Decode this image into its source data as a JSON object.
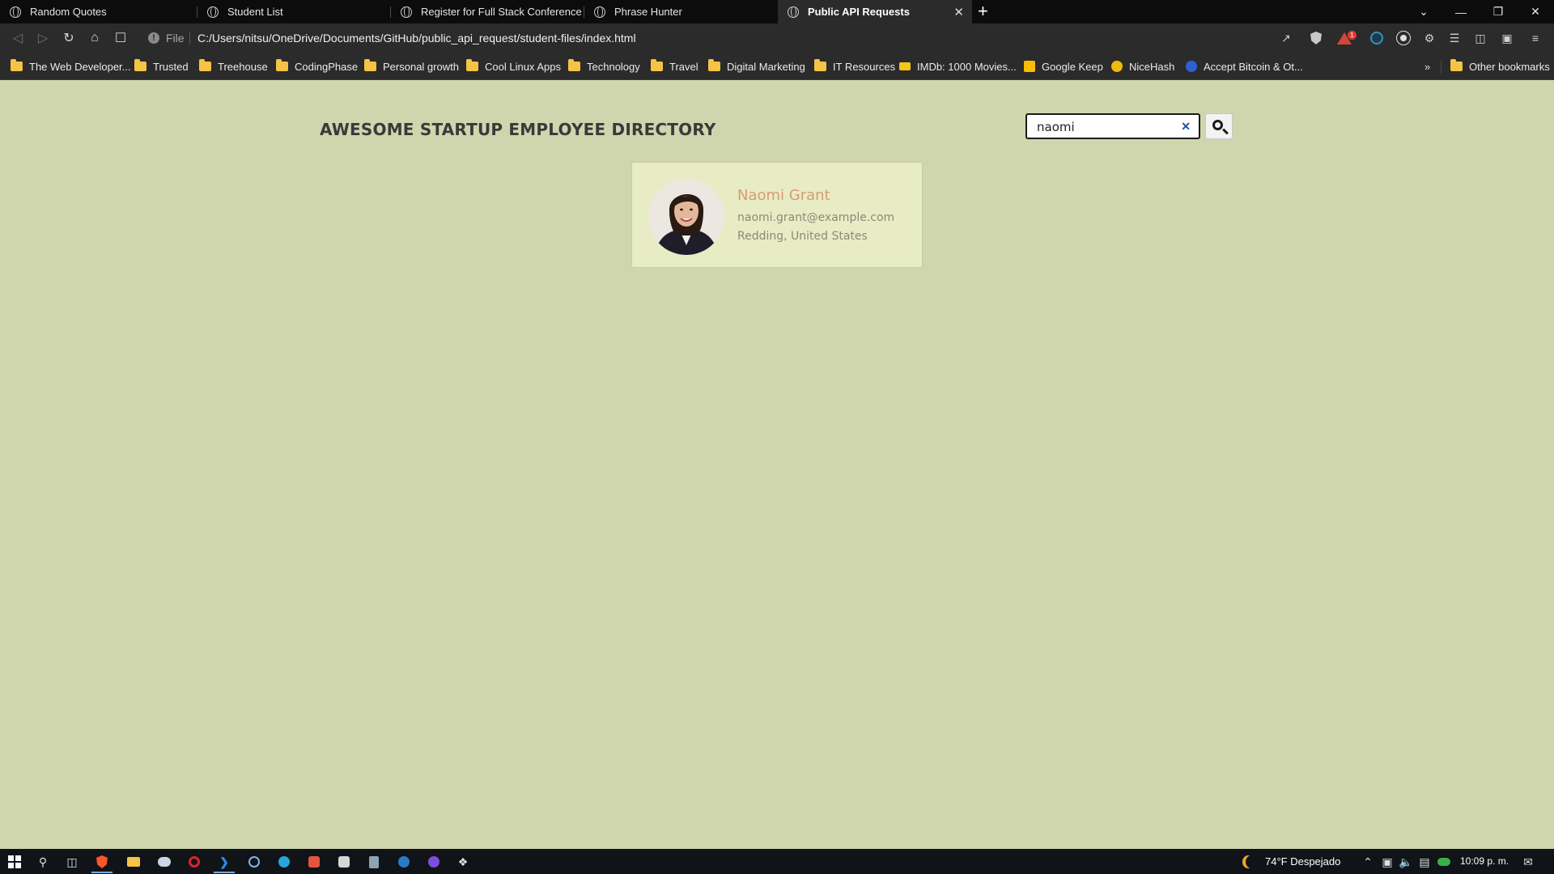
{
  "browser": {
    "tabs": [
      {
        "title": "Random Quotes",
        "active": false
      },
      {
        "title": "Student List",
        "active": false
      },
      {
        "title": "Register for Full Stack Conference",
        "active": false
      },
      {
        "title": "Phrase Hunter",
        "active": false
      },
      {
        "title": "Public API Requests",
        "active": true
      }
    ],
    "new_tab": "+",
    "tab_close": "✕",
    "window_controls": {
      "dropdown": "⌄",
      "minimize": "—",
      "restore": "❐",
      "close": "✕"
    },
    "address": {
      "scheme_label": "File",
      "url": "C:/Users/nitsu/OneDrive/Documents/GitHub/public_api_request/student-files/index.html"
    },
    "rewards_badge": "1",
    "bookmarks": [
      {
        "label": "The Web Developer...",
        "icon": "folder-icon"
      },
      {
        "label": "Trusted",
        "icon": "folder-icon"
      },
      {
        "label": "Treehouse",
        "icon": "folder-icon"
      },
      {
        "label": "CodingPhase",
        "icon": "folder-icon"
      },
      {
        "label": "Personal growth",
        "icon": "folder-icon"
      },
      {
        "label": "Cool Linux Apps",
        "icon": "folder-icon"
      },
      {
        "label": "Technology",
        "icon": "folder-icon"
      },
      {
        "label": "Travel",
        "icon": "folder-icon"
      },
      {
        "label": "Digital Marketing",
        "icon": "folder-icon"
      },
      {
        "label": "IT Resources",
        "icon": "folder-icon"
      },
      {
        "label": "IMDb: 1000 Movies...",
        "icon": "imdb-icon"
      },
      {
        "label": "Google Keep",
        "icon": "google-keep-icon"
      },
      {
        "label": "NiceHash",
        "icon": "nicehash-icon"
      },
      {
        "label": "Accept Bitcoin & Ot...",
        "icon": "bitcoin-icon"
      }
    ],
    "bookmarks_overflow": "»",
    "other_bookmarks": "Other bookmarks"
  },
  "page": {
    "title": "AWESOME STARTUP EMPLOYEE DIRECTORY",
    "search": {
      "value": "naomi",
      "clear": "✕"
    },
    "employees": [
      {
        "name": "Naomi Grant",
        "email": "naomi.grant@example.com",
        "location": "Redding, United States"
      }
    ]
  },
  "taskbar": {
    "weather": "74°F  Despejado",
    "clock": "10:09 p. m."
  },
  "colors": {
    "page_background": "#cfd6ae",
    "card_background": "#e8ecc4",
    "name_accent": "#d99a75"
  }
}
